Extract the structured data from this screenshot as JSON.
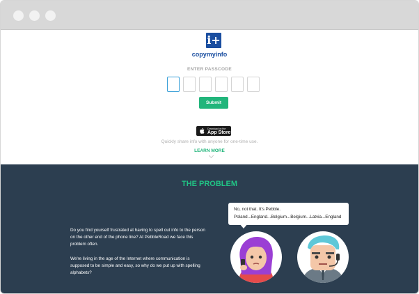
{
  "window": {
    "colors": {
      "titlebar": "#d8d8d8",
      "dots": "#f2f2f2"
    }
  },
  "brand": {
    "icon_glyph": "i+",
    "name": "copymyinfo",
    "color": "#1a4ea0"
  },
  "passcode": {
    "label": "ENTER PASSCODE",
    "digits": [
      "",
      "",
      "",
      "",
      "",
      ""
    ],
    "active_index": 0
  },
  "submit_label": "Submit",
  "app_store": {
    "small_text": "Download on the",
    "big_text": "App Store",
    "icon": "apple-icon"
  },
  "tagline": "Quickly share info with anyone for one-time use.",
  "learn_more": "LEARN MORE",
  "problem": {
    "title": "THE PROBLEM",
    "paragraph_1": "Do you find yourself frustrated at having to spell out info to the person on the other end of the phone line? At PebbleRoad we face this problem often.",
    "paragraph_2": "We're living in the age of the Internet where communication is supposed to be simple and easy, so why do we put up with spelling alphabets?",
    "bubble_line_1": "No, not that. It's Pebble.",
    "bubble_line_2": "Poland...England...Belgium...Belgium...Latvia...England",
    "colors": {
      "background": "#2c3e50",
      "accent": "#21c485"
    }
  }
}
